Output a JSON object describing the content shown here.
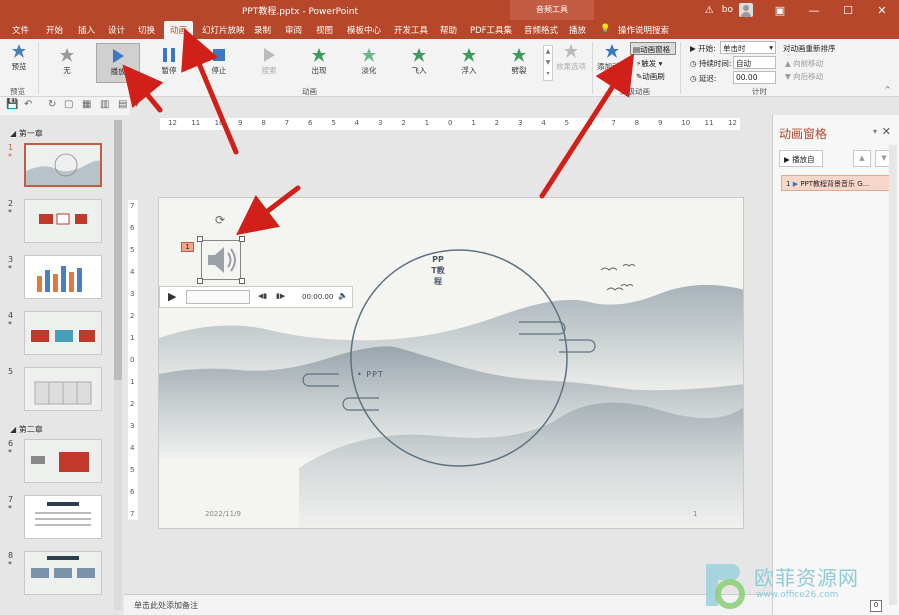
{
  "titlebar": {
    "title": "PPT教程.pptx - PowerPoint",
    "context_label": "音频工具",
    "user": "bo",
    "warning_icon": "warning-icon"
  },
  "tabs": [
    {
      "label": "文件"
    },
    {
      "label": "开始"
    },
    {
      "label": "插入"
    },
    {
      "label": "设计"
    },
    {
      "label": "切换"
    },
    {
      "label": "动画",
      "active": true
    },
    {
      "label": "幻灯片放映"
    },
    {
      "label": "录制"
    },
    {
      "label": "审阅"
    },
    {
      "label": "视图"
    },
    {
      "label": "模板中心"
    },
    {
      "label": "开发工具"
    },
    {
      "label": "帮助"
    },
    {
      "label": "PDF工具集"
    },
    {
      "label": "音频格式"
    },
    {
      "label": "播放"
    },
    {
      "label": "操作说明搜索"
    }
  ],
  "ribbon": {
    "preview": {
      "label": "预览",
      "group": "预览"
    },
    "effects": [
      {
        "label": "无"
      },
      {
        "label": "播放",
        "selected": true
      },
      {
        "label": "暂停"
      },
      {
        "label": "停止"
      },
      {
        "label": "搜索"
      },
      {
        "label": "出现"
      },
      {
        "label": "淡化"
      },
      {
        "label": "飞入"
      },
      {
        "label": "浮入"
      },
      {
        "label": "劈裂"
      }
    ],
    "effect_options": "效果选项",
    "animation_group": "动画",
    "add_animation": "添加动画",
    "animation_pane": "动画窗格",
    "trigger": "触发",
    "painter": "动画刷",
    "advanced_group": "高级动画",
    "start_label": "开始:",
    "start_value": "单击时",
    "duration_label": "持续时间:",
    "duration_value": "自动",
    "delay_label": "延迟:",
    "delay_value": "00.00",
    "reorder_title": "对动画重新排序",
    "move_earlier": "向前移动",
    "move_later": "向后移动",
    "timing_group": "计时"
  },
  "slides_pane": {
    "sections": [
      {
        "label": "第一章"
      },
      {
        "label": "第二章"
      }
    ],
    "thumbs": [
      {
        "num": "1",
        "star": "*"
      },
      {
        "num": "2",
        "star": "*"
      },
      {
        "num": "3",
        "star": "*"
      },
      {
        "num": "4",
        "star": "*"
      },
      {
        "num": "5",
        "star": ""
      },
      {
        "num": "6",
        "star": "*"
      },
      {
        "num": "7",
        "star": "*"
      },
      {
        "num": "8",
        "star": "*"
      }
    ]
  },
  "ruler": {
    "h_ticks": [
      "12",
      "11",
      "10",
      "9",
      "8",
      "7",
      "6",
      "5",
      "4",
      "3",
      "2",
      "1",
      "0",
      "1",
      "2",
      "3",
      "4",
      "5",
      "6",
      "7",
      "8",
      "9",
      "10",
      "11",
      "12"
    ],
    "v_ticks": [
      "7",
      "6",
      "5",
      "4",
      "3",
      "2",
      "1",
      "0",
      "1",
      "2",
      "3",
      "4",
      "5",
      "6",
      "7"
    ]
  },
  "slide": {
    "anim_tag": "1",
    "audio_time": "00:00.00",
    "vertical_title": "PPT教程",
    "subtitle": "• PPT",
    "date": "2022/11/9",
    "page": "1"
  },
  "notes": "单击此处添加备注",
  "anim_pane": {
    "title": "动画窗格",
    "play_from": "播放自",
    "item_num": "1",
    "item_label": "PPT教程背景音乐 G..."
  },
  "watermark": {
    "brand": "欧菲资源网",
    "url": "www.office26.com"
  },
  "status": {
    "right": "0"
  },
  "colors": {
    "accent": "#b7472a",
    "arrow": "#d11f1a",
    "selection": "#c45c43"
  }
}
